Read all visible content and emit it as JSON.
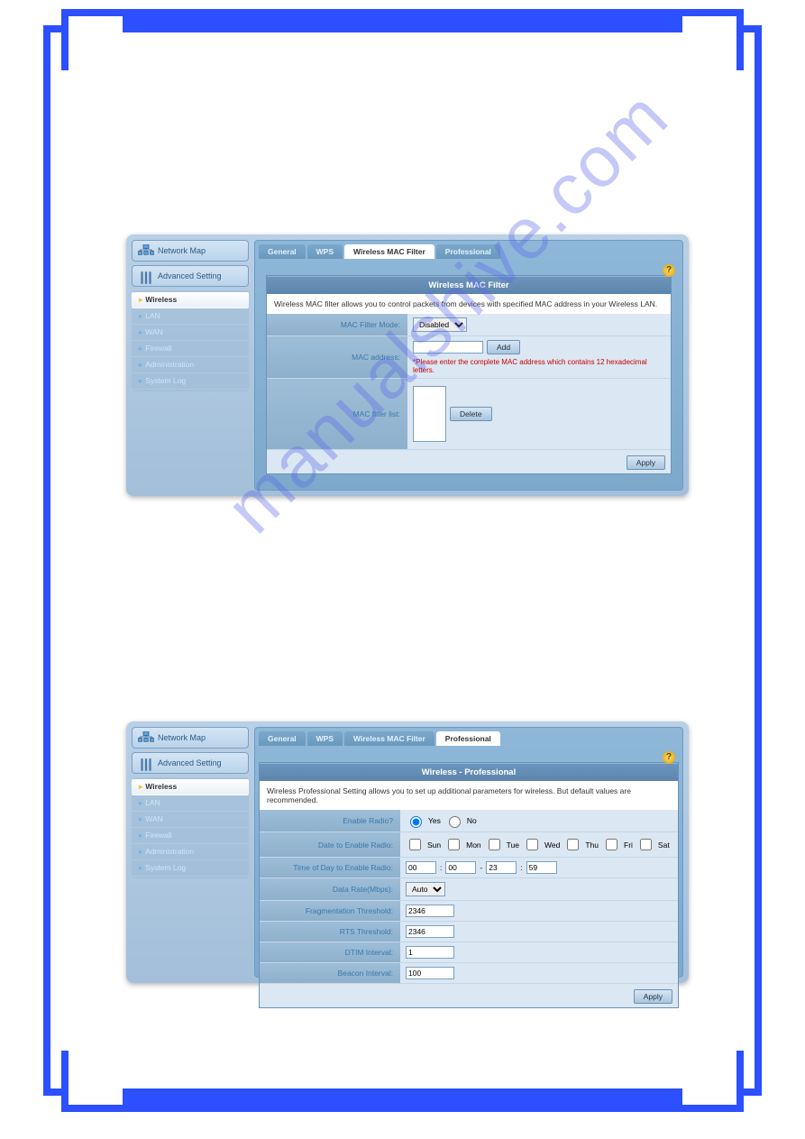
{
  "watermark": "manualshive.com",
  "sidebar": {
    "network_map": "Network Map",
    "advanced_setting": "Advanced Setting",
    "items": [
      {
        "label": "Wireless",
        "active": true
      },
      {
        "label": "LAN"
      },
      {
        "label": "WAN"
      },
      {
        "label": "Firewall"
      },
      {
        "label": "Administration"
      },
      {
        "label": "System Log"
      }
    ]
  },
  "tabs": [
    "General",
    "WPS",
    "Wireless MAC Filter",
    "Professional"
  ],
  "help_icon": "?",
  "panel1": {
    "active_tab": "Wireless MAC Filter",
    "title": "Wireless MAC Filter",
    "desc": "Wireless MAC filter allows you to control packets from devices with specified MAC address in your Wireless LAN.",
    "rows": {
      "filter_mode": {
        "label": "MAC Filter Mode:",
        "value": "Disabled"
      },
      "mac_address": {
        "label": "MAC address:",
        "add_btn": "Add",
        "error": "*Please enter the complete MAC address which contains 12 hexadecimal letters."
      },
      "filter_list": {
        "label": "MAC filter list:",
        "delete_btn": "Delete"
      }
    },
    "apply": "Apply"
  },
  "panel2": {
    "active_tab": "Professional",
    "title": "Wireless - Professional",
    "desc": "Wireless Professional Setting allows you to set up additional parameters for wireless. But default values are recommended.",
    "rows": {
      "enable_radio": {
        "label": "Enable Radio?",
        "yes": "Yes",
        "no": "No"
      },
      "date_enable": {
        "label": "Date to Enable Radio:",
        "days": [
          "Sun",
          "Mon",
          "Tue",
          "Wed",
          "Thu",
          "Fri",
          "Sat"
        ]
      },
      "time_enable": {
        "label": "Time of Day to Enable Radio:",
        "h1": "00",
        "m1": "00",
        "h2": "23",
        "m2": "59"
      },
      "data_rate": {
        "label": "Data Rate(Mbps):",
        "value": "Auto"
      },
      "frag": {
        "label": "Fragmentation Threshold:",
        "value": "2346"
      },
      "rts": {
        "label": "RTS Threshold:",
        "value": "2346"
      },
      "dtim": {
        "label": "DTIM Interval:",
        "value": "1"
      },
      "beacon": {
        "label": "Beacon Interval:",
        "value": "100"
      }
    },
    "apply": "Apply"
  }
}
